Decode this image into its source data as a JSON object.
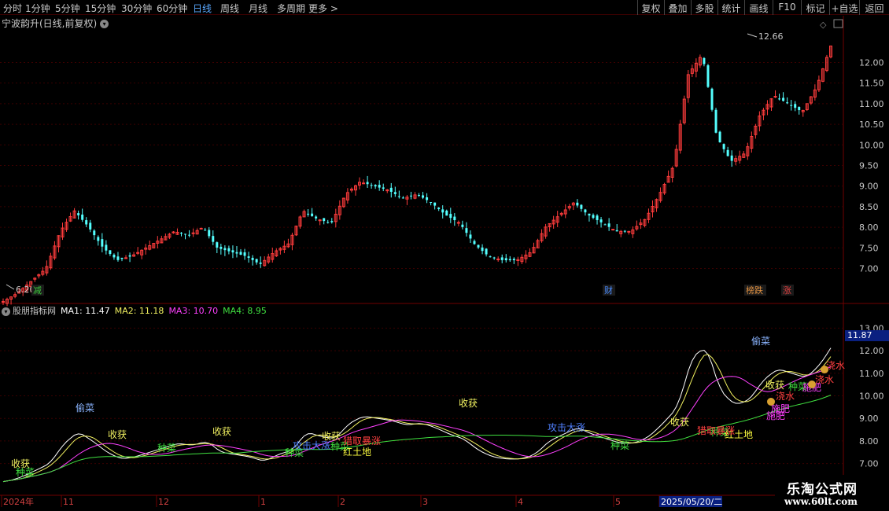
{
  "toolbar": {
    "periods": [
      "分时",
      "1分钟",
      "5分钟",
      "15分钟",
      "30分钟",
      "60分钟",
      "日线",
      "周线",
      "月线",
      "多周期",
      "更多 >"
    ],
    "active": "日线",
    "actions": [
      "复权",
      "叠加",
      "多股",
      "统计",
      "画线",
      "F10",
      "标记",
      "+自选",
      "返回"
    ]
  },
  "main_chart": {
    "title": "宁波韵升(日线,前复权)",
    "high_label": "12.66",
    "low_label": "6.20",
    "y_ticks": [
      "12.00",
      "11.50",
      "11.00",
      "10.50",
      "10.00",
      "9.50",
      "9.00",
      "8.50",
      "8.00",
      "7.50",
      "7.00"
    ],
    "event_tags": [
      {
        "text": "减",
        "color": "#3cc83c"
      },
      {
        "text": "财",
        "color": "#4a8cff"
      },
      {
        "text": "榜跌",
        "color": "#e09040"
      },
      {
        "text": "涨",
        "color": "#e04040"
      }
    ]
  },
  "indicator": {
    "name": "股朋指标网",
    "ma": [
      {
        "label": "MA1: 11.47",
        "color": "#ffffff"
      },
      {
        "label": "MA2: 11.18",
        "color": "#f0f060"
      },
      {
        "label": "MA3: 10.70",
        "color": "#ff40ff"
      },
      {
        "label": "MA4: 8.95",
        "color": "#40e040"
      }
    ],
    "y_ticks": [
      "13.00",
      "12.00",
      "11.00",
      "10.00",
      "9.00",
      "8.00",
      "7.00"
    ],
    "current_value": "11.87",
    "signals": [
      "偷菜",
      "收获",
      "种菜",
      "红土地",
      "攻击大涨",
      "猎取暴涨",
      "浇水",
      "施肥"
    ]
  },
  "time_axis": {
    "labels": [
      "2024年",
      "11",
      "12",
      "1",
      "2",
      "3",
      "4",
      "5",
      "2025/05/20/二"
    ]
  },
  "watermark": {
    "line1": "乐淘公式网",
    "line2": "www.60lt.com"
  },
  "chart_data": {
    "type": "candlestick",
    "title": "宁波韵升(日线,前复权)",
    "period": "日线",
    "price_high": 12.66,
    "price_low": 6.2,
    "ylim": [
      6.8,
      12.6
    ],
    "close_path": [
      6.2,
      6.4,
      6.7,
      7.0,
      7.9,
      8.4,
      8.0,
      7.5,
      7.2,
      7.3,
      7.5,
      7.7,
      7.9,
      7.8,
      8.0,
      7.5,
      7.4,
      7.3,
      7.1,
      7.4,
      7.6,
      8.4,
      8.2,
      8.1,
      8.8,
      9.1,
      9.0,
      8.9,
      8.7,
      8.8,
      8.6,
      8.3,
      8.1,
      7.6,
      7.3,
      7.2,
      7.2,
      7.4,
      8.0,
      8.3,
      8.6,
      8.3,
      8.1,
      7.9,
      7.9,
      8.2,
      8.8,
      9.5,
      11.7,
      12.2,
      10.2,
      9.6,
      9.8,
      10.7,
      11.2,
      11.0,
      10.8,
      11.4,
      12.4
    ],
    "ma_lines": {
      "MA1": 11.47,
      "MA2": 11.18,
      "MA3": 10.7,
      "MA4": 8.95
    },
    "indicator_ylim": [
      6.5,
      13.5
    ]
  }
}
